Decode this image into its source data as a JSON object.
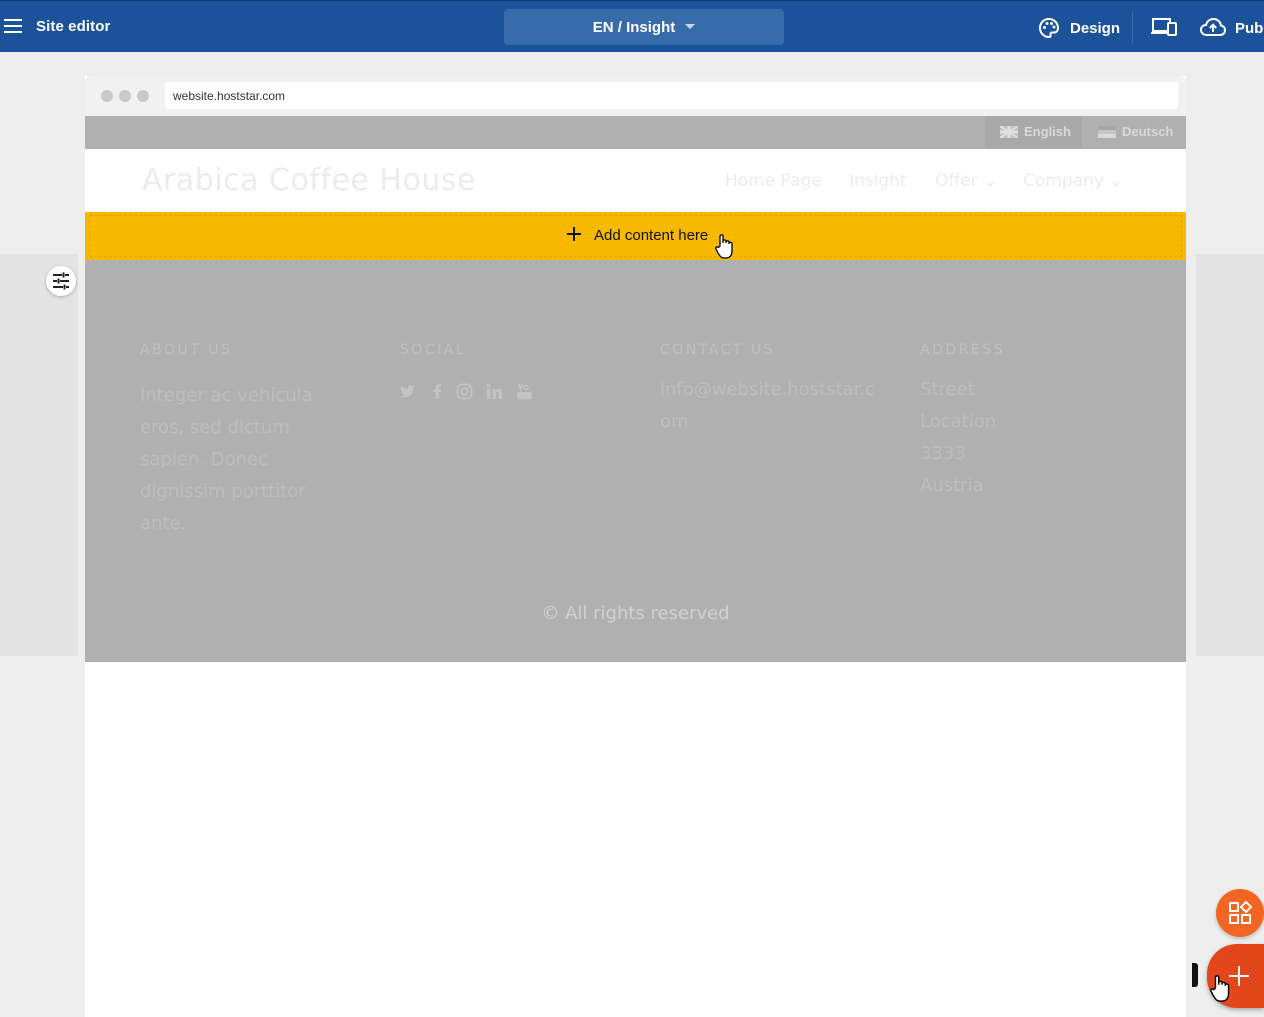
{
  "editor": {
    "title": "Site editor",
    "page_selector": "EN / Insight",
    "design_label": "Design",
    "publish_label": "Publ"
  },
  "browser": {
    "url": "website.hoststar.com"
  },
  "languages": [
    {
      "label": "English",
      "active": true
    },
    {
      "label": "Deutsch",
      "active": false
    }
  ],
  "site": {
    "logo": "Arabica Coffee House",
    "nav": [
      {
        "label": "Home Page"
      },
      {
        "label": "Insight"
      },
      {
        "label": "Offer ⌄"
      },
      {
        "label": "Company ⌄"
      }
    ]
  },
  "add_content": {
    "label": "Add content here"
  },
  "footer": {
    "columns": [
      {
        "heading": "ABOUT US",
        "lines": [
          "Integer ac vehicula",
          "eros, sed dictum",
          "sapien. Donec",
          "dignissim porttitor",
          "ante."
        ]
      },
      {
        "heading": "SOCIAL",
        "icons": [
          "twitter-icon",
          "facebook-icon",
          "instagram-icon",
          "linkedin-icon",
          "youtube-icon"
        ]
      },
      {
        "heading": "CONTACT US",
        "lines": [
          "info@website.hoststar.c",
          "om"
        ]
      },
      {
        "heading": "ADDRESS",
        "lines": [
          "Street",
          "Location",
          "3333",
          "Austria"
        ]
      }
    ],
    "copyright": "© All rights reserved"
  },
  "colors": {
    "editor_bar": "#1c5299",
    "add_content_bg": "#f7b800",
    "fab_orange": "#f26522",
    "fab_red": "#e4461c"
  }
}
